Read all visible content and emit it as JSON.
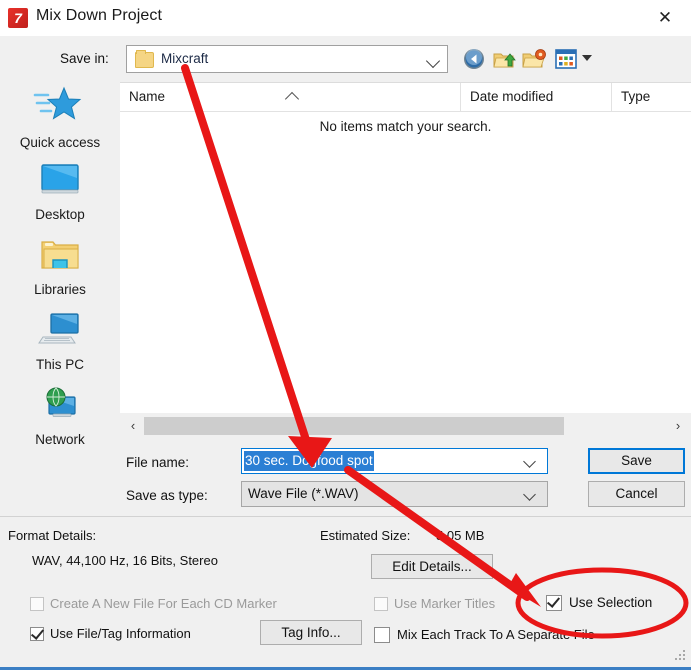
{
  "window": {
    "title": "Mix Down Project",
    "app_icon": "mixcraft-7-icon",
    "close_label": "✕"
  },
  "toolbar": {
    "save_in_label": "Save in:",
    "current_folder": "Mixcraft",
    "icons": [
      {
        "name": "back-icon",
        "tooltip": "Back"
      },
      {
        "name": "up-folder-icon",
        "tooltip": "Up one level"
      },
      {
        "name": "new-folder-icon",
        "tooltip": "Create New Folder"
      },
      {
        "name": "view-options-icon",
        "tooltip": "Views"
      }
    ]
  },
  "sidebar": {
    "items": [
      {
        "label": "Quick access",
        "icon": "star-icon"
      },
      {
        "label": "Desktop",
        "icon": "monitor-icon"
      },
      {
        "label": "Libraries",
        "icon": "folder-icon"
      },
      {
        "label": "This PC",
        "icon": "computer-icon"
      },
      {
        "label": "Network",
        "icon": "globe-monitor-icon"
      }
    ]
  },
  "file_list": {
    "columns": [
      "Name",
      "Date modified",
      "Type"
    ],
    "sort_column": "Name",
    "sort_direction": "ascending",
    "empty_message": "No items match your search.",
    "rows": []
  },
  "scrollbar": {
    "left_arrow": "‹",
    "right_arrow": "›"
  },
  "form": {
    "file_name_label": "File name:",
    "file_name_value": "30 sec. Dogfood spot",
    "save_as_type_label": "Save as type:",
    "save_as_type_value": "Wave File (*.WAV)",
    "save_button": "Save",
    "cancel_button": "Cancel"
  },
  "format": {
    "details_label": "Format Details:",
    "details_value": "WAV, 44,100 Hz, 16 Bits, Stereo",
    "estimated_size_label": "Estimated Size:",
    "estimated_size_value": "5.05 MB",
    "edit_details_button": "Edit Details...",
    "tag_info_button": "Tag Info..."
  },
  "options": [
    {
      "label": "Create A New File For Each CD Marker",
      "checked": false,
      "disabled": true
    },
    {
      "label": "Use Marker Titles",
      "checked": false,
      "disabled": true
    },
    {
      "label": "Use Selection",
      "checked": true,
      "disabled": false,
      "highlighted": true
    },
    {
      "label": "Use File/Tag Information",
      "checked": true,
      "disabled": false
    },
    {
      "label": "Mix Each Track To A Separate File",
      "checked": false,
      "disabled": false
    }
  ],
  "annotations": {
    "color": "#e81717",
    "arrow_1": "from folder name Mixcraft to File name field",
    "arrow_2": "from File name field to Use Selection checkbox",
    "ellipse": "circles the Use Selection checkbox"
  }
}
